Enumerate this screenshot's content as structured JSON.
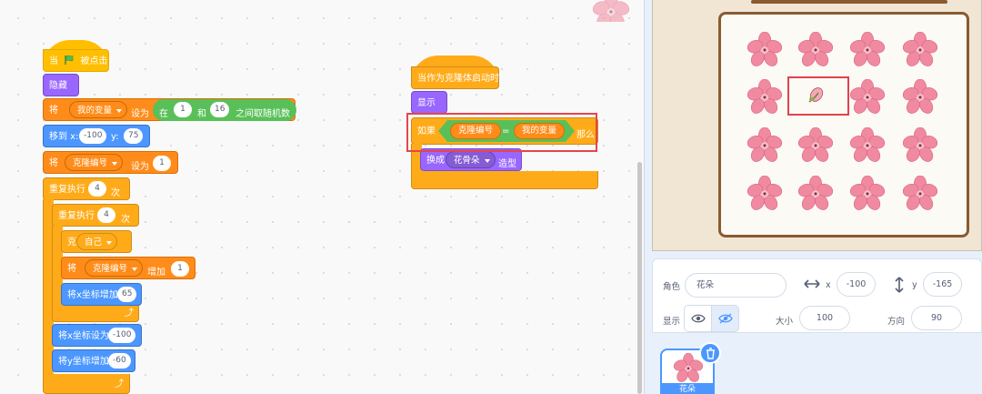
{
  "script1": {
    "when_label": "当",
    "clicked_label": "被点击",
    "hide": "隐藏",
    "set_rand": {
      "set": "将",
      "var": "我的变量",
      "to": "设为",
      "in": "在",
      "from": "1",
      "and": "和",
      "to_num": "16",
      "suffix": "之间取随机数"
    },
    "goto": {
      "label": "移到 x:",
      "x": "-100",
      "ylabel": "y:",
      "y": "75"
    },
    "set_id": {
      "set": "将",
      "var": "克隆编号",
      "to": "设为",
      "value": "1"
    },
    "outer_repeat": {
      "label": "重复执行",
      "count": "4",
      "suffix": "次"
    },
    "inner_repeat": {
      "label": "重复执行",
      "count": "4",
      "suffix": "次"
    },
    "clone": {
      "label": "克隆",
      "target": "自己"
    },
    "change_id": {
      "set": "将",
      "var": "克隆编号",
      "by": "增加",
      "value": "1"
    },
    "change_x": {
      "label": "将x坐标增加",
      "value": "65"
    },
    "set_x": {
      "label": "将x坐标设为",
      "value": "-100"
    },
    "change_y": {
      "label": "将y坐标增加",
      "value": "-60"
    }
  },
  "script2": {
    "hat": "当作为克隆体启动时",
    "show": "显示",
    "if": {
      "label": "如果",
      "left": "克隆编号",
      "op": "=",
      "right": "我的变量",
      "then": "那么"
    },
    "switch": {
      "label": "换成",
      "costume": "花骨朵",
      "suffix": "造型"
    }
  },
  "sprite_info": {
    "sprite_label": "角色",
    "sprite_name": "花朵",
    "x_label": "x",
    "x": "-100",
    "y_label": "y",
    "y": "-165",
    "show_label": "显示",
    "size_label": "大小",
    "size": "100",
    "dir_label": "方向",
    "direction": "90"
  },
  "sprite_list": [
    {
      "name": "花朵"
    }
  ],
  "colors": {
    "events": "#ffbf00",
    "looks": "#9966ff",
    "motion": "#4c97ff",
    "control": "#ffab19",
    "variables": "#ff8c1a",
    "operators": "#59c059",
    "highlight": "#e8444c"
  }
}
